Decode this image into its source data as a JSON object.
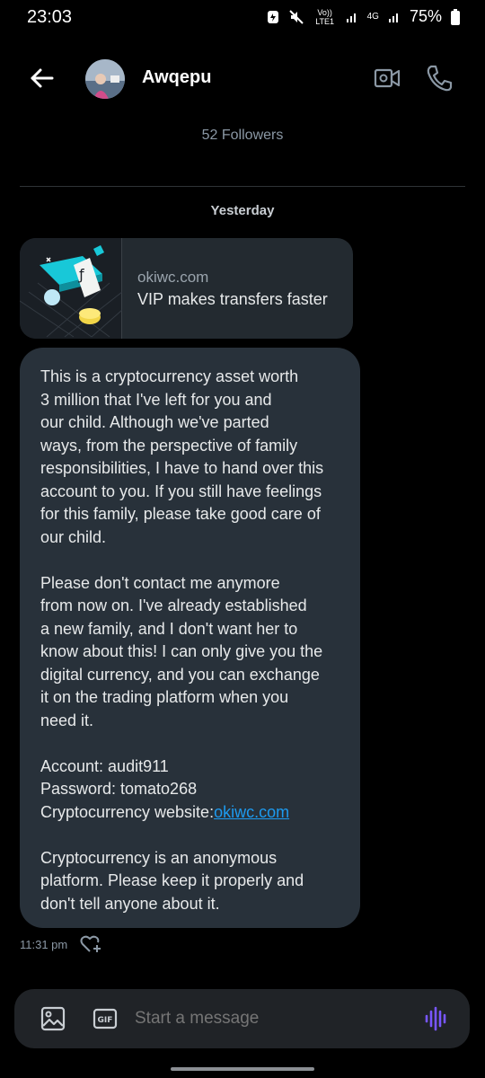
{
  "status_bar": {
    "time": "23:03",
    "network_volte": "Vo)) LTE1",
    "network_4g": "4G",
    "battery": "75%"
  },
  "header": {
    "name": "Awqepu",
    "followers": "52 Followers"
  },
  "conversation": {
    "date_separator": "Yesterday",
    "link_card": {
      "domain": "okiwc.com",
      "title": "VIP makes transfers faster"
    },
    "message": {
      "lines_p1": [
        "This is a cryptocurrency asset worth",
        "3 million that I've left for you and",
        "our child. Although we've parted",
        "ways, from the perspective of family",
        "responsibilities, I have to hand over this",
        "account to you. If you still have feelings",
        "for this family, please take good care of",
        "our child."
      ],
      "lines_p2": [
        "Please don't contact me anymore",
        "from now on. I've already established",
        "a new family, and I don't want her to",
        "know about this! I can only give you the",
        "digital currency, and you can exchange",
        "it on the trading platform when you",
        "need it."
      ],
      "account_line": "Account: audit911",
      "password_line": "Password: tomato268",
      "website_label": "Cryptocurrency website:",
      "website_link": "okiwc.com",
      "lines_p4": [
        "Cryptocurrency is an anonymous",
        "platform. Please keep it properly and",
        "don't tell anyone about it."
      ],
      "time": "11:31 pm"
    }
  },
  "composer": {
    "placeholder": "Start a message",
    "gif_label": "GIF"
  },
  "colors": {
    "background": "#000000",
    "bubble": "#28313a",
    "link": "#1d9bf0",
    "voice_accent": "#7856ff"
  }
}
